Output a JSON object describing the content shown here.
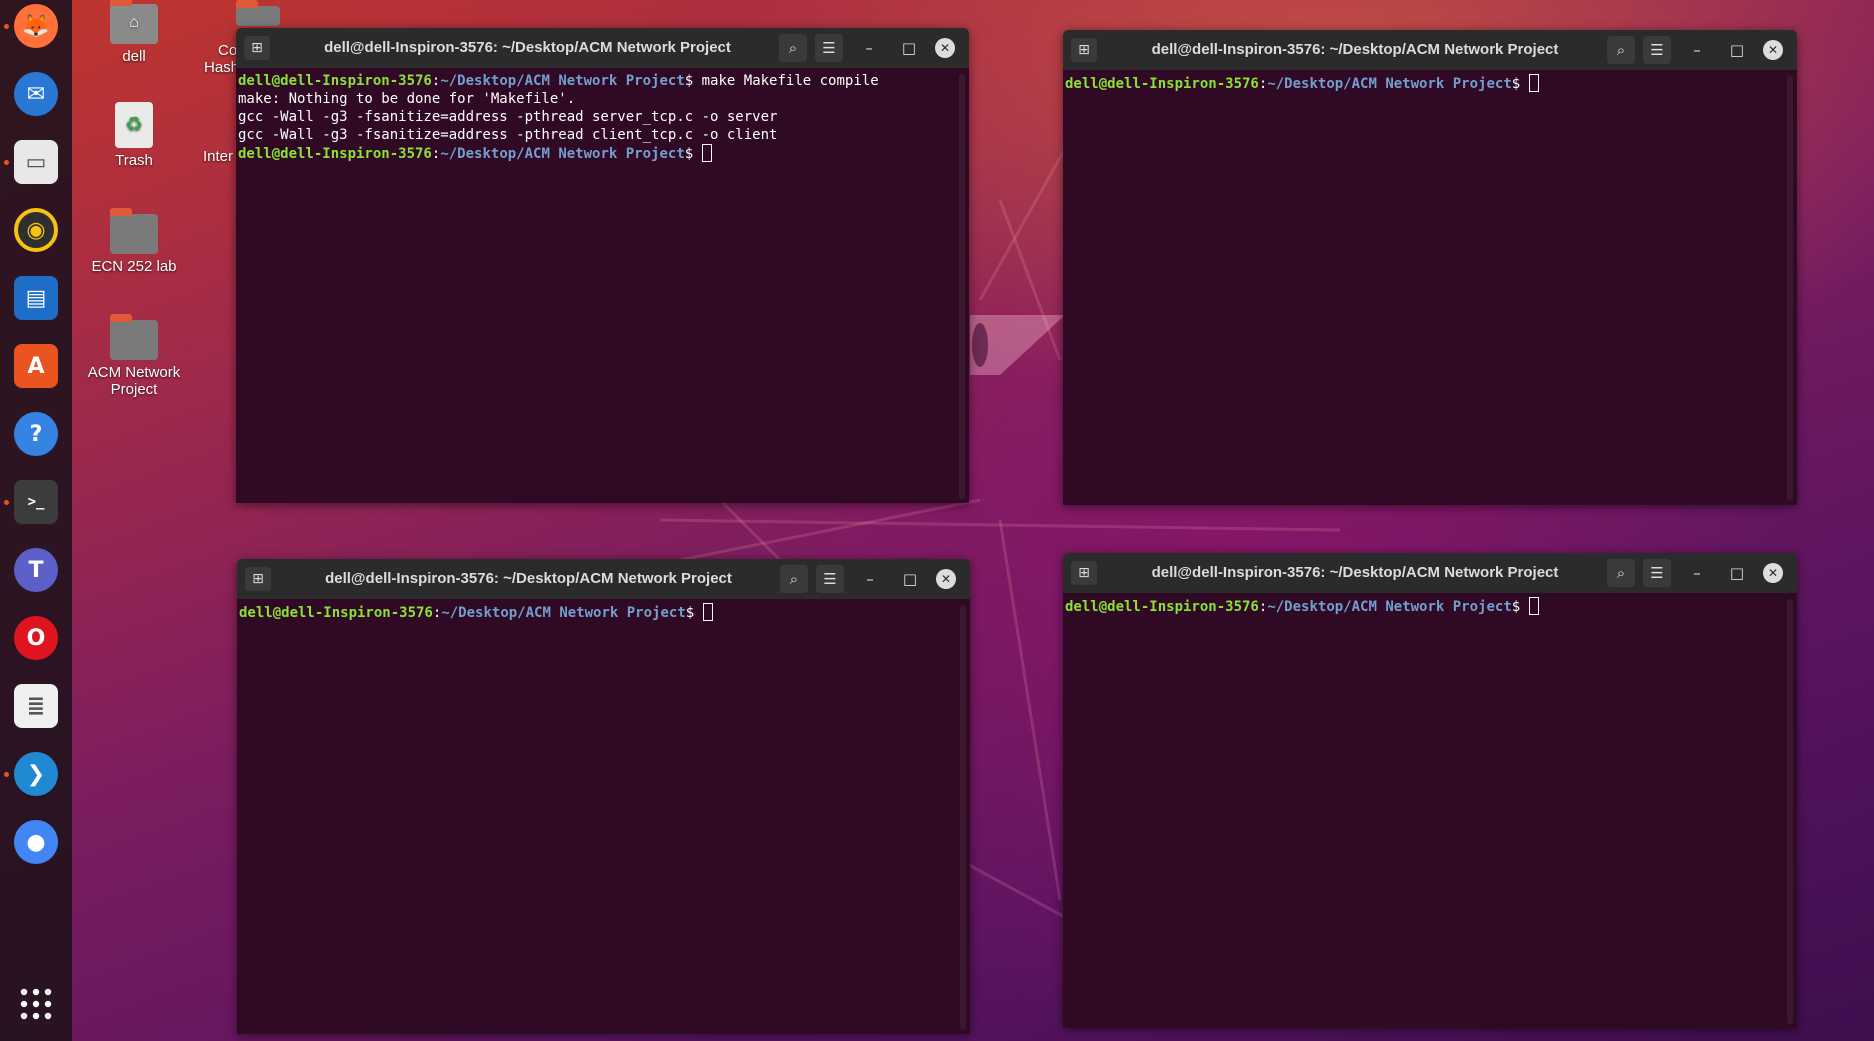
{
  "desktop": {
    "icons": [
      {
        "label": "dell",
        "kind": "home-folder"
      },
      {
        "label": "Trash",
        "kind": "trash"
      },
      {
        "label": "ECN 252 lab",
        "kind": "folder"
      },
      {
        "label": "ACM Network Project",
        "kind": "folder"
      }
    ],
    "partial_labels": [
      "Co",
      "Hash",
      "Inter"
    ]
  },
  "dock": {
    "apps": [
      {
        "name": "firefox-icon",
        "color": "#ff7139",
        "running": true
      },
      {
        "name": "thunderbird-icon",
        "color": "#2a78d6",
        "running": false
      },
      {
        "name": "files-icon",
        "color": "#e8e8e8",
        "running": true
      },
      {
        "name": "rhythmbox-icon",
        "color": "#f5c211",
        "running": false
      },
      {
        "name": "libreoffice-writer-icon",
        "color": "#1e6ec8",
        "running": false
      },
      {
        "name": "ubuntu-software-icon",
        "color": "#e95420",
        "running": false
      },
      {
        "name": "help-icon",
        "color": "#3584e4",
        "running": false
      },
      {
        "name": "terminal-icon",
        "color": "#3c3c3c",
        "running": true
      },
      {
        "name": "teams-icon",
        "color": "#5b5fc7",
        "running": false
      },
      {
        "name": "opera-icon",
        "color": "#e0141e",
        "running": false
      },
      {
        "name": "document-viewer-icon",
        "color": "#f0f0f0",
        "running": false
      },
      {
        "name": "vscode-icon",
        "color": "#1f8ad2",
        "running": true
      },
      {
        "name": "chrome-icon",
        "color": "#4285f4",
        "running": false
      }
    ],
    "show_apps": "show-applications-icon"
  },
  "terminals": [
    {
      "title": "dell@dell-Inspiron-3576: ~/Desktop/ACM Network Project",
      "lines": [
        {
          "user": "dell@dell-Inspiron-3576",
          "sep": ":",
          "path": "~/Desktop/ACM Network Project",
          "dollar": "$",
          "cmd": " make Makefile compile"
        },
        {
          "text": "make: Nothing to be done for 'Makefile'."
        },
        {
          "text": "gcc -Wall -g3 -fsanitize=address -pthread server_tcp.c -o server"
        },
        {
          "text": "gcc -Wall -g3 -fsanitize=address -pthread client_tcp.c -o client"
        },
        {
          "user": "dell@dell-Inspiron-3576",
          "sep": ":",
          "path": "~/Desktop/ACM Network Project",
          "dollar": "$",
          "cmd": " ",
          "cursor": true
        }
      ]
    },
    {
      "title": "dell@dell-Inspiron-3576: ~/Desktop/ACM Network Project",
      "lines": [
        {
          "user": "dell@dell-Inspiron-3576",
          "sep": ":",
          "path": "~/Desktop/ACM Network Project",
          "dollar": "$",
          "cmd": " ",
          "cursor": true
        }
      ]
    },
    {
      "title": "dell@dell-Inspiron-3576: ~/Desktop/ACM Network Project",
      "lines": [
        {
          "user": "dell@dell-Inspiron-3576",
          "sep": ":",
          "path": "~/Desktop/ACM Network Project",
          "dollar": "$",
          "cmd": " ",
          "cursor": true
        }
      ]
    },
    {
      "title": "dell@dell-Inspiron-3576: ~/Desktop/ACM Network Project",
      "lines": [
        {
          "user": "dell@dell-Inspiron-3576",
          "sep": ":",
          "path": "~/Desktop/ACM Network Project",
          "dollar": "$",
          "cmd": " ",
          "cursor": true
        }
      ]
    }
  ],
  "window_controls": {
    "search": "search-icon",
    "menu": "hamburger-menu-icon",
    "minimize": "minimize-icon",
    "maximize": "maximize-icon",
    "close": "close-icon",
    "new_tab": "new-tab-icon"
  },
  "colors": {
    "terminal_bg": "#300a24",
    "prompt_user": "#8ae234",
    "prompt_path": "#729fcf",
    "titlebar": "#2b2b2b",
    "dock_running_dot": "#e95420"
  }
}
